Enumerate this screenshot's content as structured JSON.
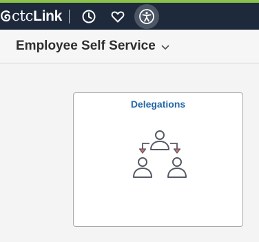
{
  "colors": {
    "accent_bar": "#8bc34a",
    "topbar_bg": "#1e2a3b",
    "tile_title": "#2367a8",
    "arrow_red": "#d9534f"
  },
  "brand": {
    "mark_icon": "ctclink-swirl-icon",
    "text_light": "ctc",
    "text_bold": "Link"
  },
  "toolbar": {
    "icons": [
      "recent-history-icon",
      "favorites-heart-icon",
      "accessibility-icon"
    ]
  },
  "header": {
    "title": "Employee Self Service",
    "dropdown_icon": "chevron-down-icon"
  },
  "tiles": [
    {
      "title": "Delegations",
      "icon": "delegations-people-icon"
    }
  ]
}
